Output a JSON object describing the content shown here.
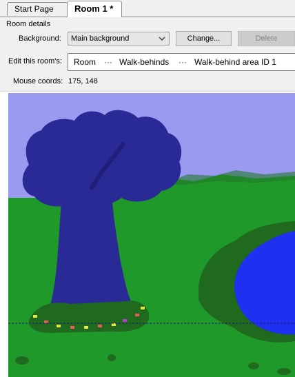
{
  "tabs": [
    {
      "label": "Start Page"
    },
    {
      "label": "Room 1 *"
    }
  ],
  "room_details": {
    "group_label": "Room details",
    "background_label": "Background:",
    "background_value": "Main background",
    "change_button": "Change...",
    "delete_button": "Delete",
    "edit_label": "Edit this room's:",
    "path": [
      "Room",
      "Walk-behinds",
      "Walk-behind area ID 1"
    ],
    "path_separator": "···",
    "mouse_label": "Mouse coords:",
    "mouse_value": "175, 148"
  },
  "colors": {
    "sky": "#9a9af0",
    "grass": "#1f9a2a",
    "tree": "#2a2a96",
    "lake": "#1f30f0",
    "bush": "#1f6a1f",
    "walk_behind_line": "#1a1a6a"
  }
}
